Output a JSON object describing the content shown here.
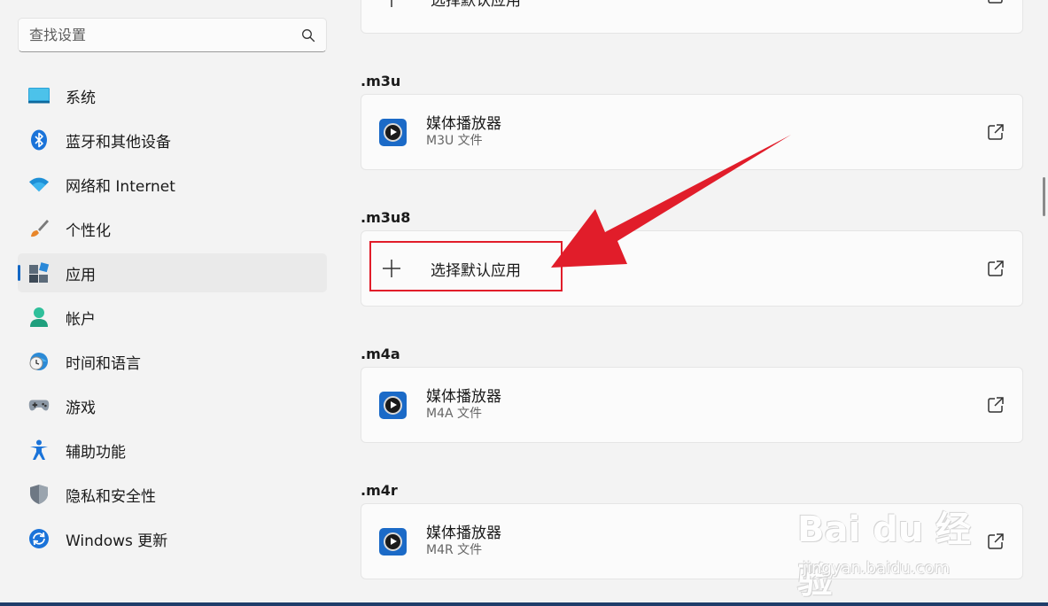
{
  "search": {
    "placeholder": "查找设置",
    "icon": "search-icon"
  },
  "nav": [
    {
      "label": "系统",
      "icon": "monitor-icon"
    },
    {
      "label": "蓝牙和其他设备",
      "icon": "bluetooth-icon"
    },
    {
      "label": "网络和 Internet",
      "icon": "wifi-icon"
    },
    {
      "label": "个性化",
      "icon": "brush-icon"
    },
    {
      "label": "应用",
      "icon": "apps-icon",
      "active": true
    },
    {
      "label": "帐户",
      "icon": "person-icon"
    },
    {
      "label": "时间和语言",
      "icon": "clock-globe-icon"
    },
    {
      "label": "游戏",
      "icon": "gamepad-icon"
    },
    {
      "label": "辅助功能",
      "icon": "accessibility-icon"
    },
    {
      "label": "隐私和安全性",
      "icon": "shield-icon"
    },
    {
      "label": "Windows 更新",
      "icon": "update-icon"
    }
  ],
  "top_partial": {
    "label": "选择默认应用"
  },
  "associations": [
    {
      "ext": ".m3u",
      "app": "媒体播放器",
      "type": "M3U 文件"
    },
    {
      "ext": ".m3u8",
      "app": null,
      "choose_label": "选择默认应用"
    },
    {
      "ext": ".m4a",
      "app": "媒体播放器",
      "type": "M4A 文件"
    },
    {
      "ext": ".m4r",
      "app": "媒体播放器",
      "type": "M4R 文件"
    }
  ],
  "watermark": {
    "brand": "Bai du 经验",
    "url": "jingyan.baidu.com"
  },
  "colors": {
    "accent": "#1367c4",
    "annotation_red": "#e11d2a",
    "app_icon_blue": "#1b6ac7"
  }
}
